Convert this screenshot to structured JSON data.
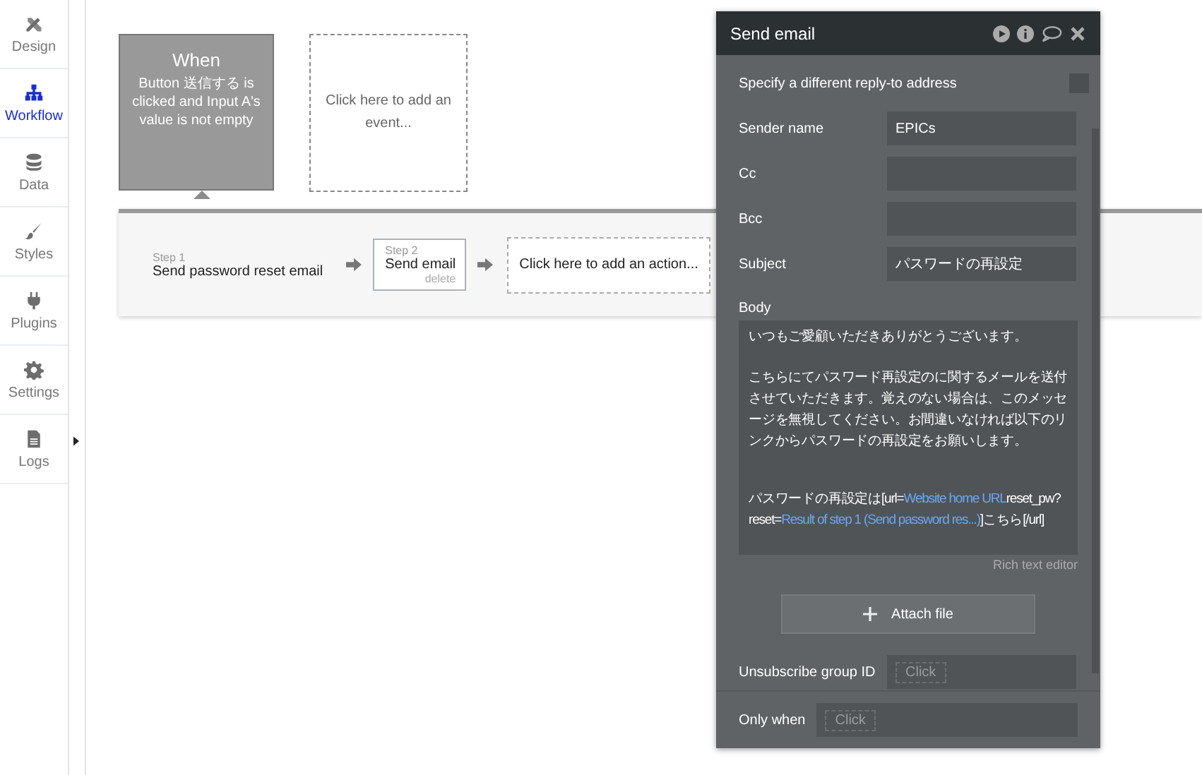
{
  "sidebar": {
    "items": [
      {
        "label": "Design",
        "selected": false
      },
      {
        "label": "Workflow",
        "selected": true
      },
      {
        "label": "Data",
        "selected": false
      },
      {
        "label": "Styles",
        "selected": false
      },
      {
        "label": "Plugins",
        "selected": false
      },
      {
        "label": "Settings",
        "selected": false
      },
      {
        "label": "Logs",
        "selected": false
      }
    ]
  },
  "events": [
    {
      "kind": "event",
      "title": "When",
      "description": "Button 送信する is clicked and Input A's value is not empty",
      "selected": true
    },
    {
      "kind": "add",
      "description": "Click here to add an event..."
    }
  ],
  "steps": [
    {
      "kind": "step",
      "step_label": "Step 1",
      "name": "Send password reset email",
      "selected": false
    },
    {
      "kind": "step",
      "step_label": "Step 2",
      "name": "Send email",
      "delete_label": "delete",
      "selected": true
    },
    {
      "kind": "add",
      "name": "Click here to add an action..."
    }
  ],
  "panel": {
    "title": "Send email",
    "reply_to": {
      "label": "Specify a different reply-to address",
      "checked": false
    },
    "fields": [
      {
        "label": "Sender name",
        "value": "EPICs"
      },
      {
        "label": "Cc"
      },
      {
        "label": "Bcc"
      },
      {
        "label": "Subject",
        "value": "パスワードの再設定"
      }
    ],
    "body": {
      "label": "Body",
      "paragraphs": [
        [
          {
            "kind": "plain",
            "text": "いつもご愛顧いただきありがとうございます。"
          }
        ],
        [
          {
            "kind": "plain",
            "text": "こちらにてパスワード再設定のに関するメールを送付させていただきます。覚えのない場合は、このメッセージを無視してください。お間違いなければ以下のリンクからパスワードの再設定をお願いします。"
          }
        ],
        [
          {
            "kind": "plain",
            "text": "パスワードの再設定は[url="
          },
          {
            "kind": "dynamic",
            "text": "Website home URL"
          },
          {
            "kind": "plain",
            "text": "reset_pw?reset="
          },
          {
            "kind": "dynamic",
            "text": "Result of step 1 (Send password res...)"
          },
          {
            "kind": "plain",
            "text": "]こちら[/url]"
          }
        ]
      ],
      "editor_link": "Rich text editor"
    },
    "attach_button": "Attach file",
    "unsubscribe": {
      "label": "Unsubscribe group ID",
      "placeholder": "Click"
    },
    "only_when": {
      "label": "Only when",
      "placeholder": "Click"
    }
  }
}
